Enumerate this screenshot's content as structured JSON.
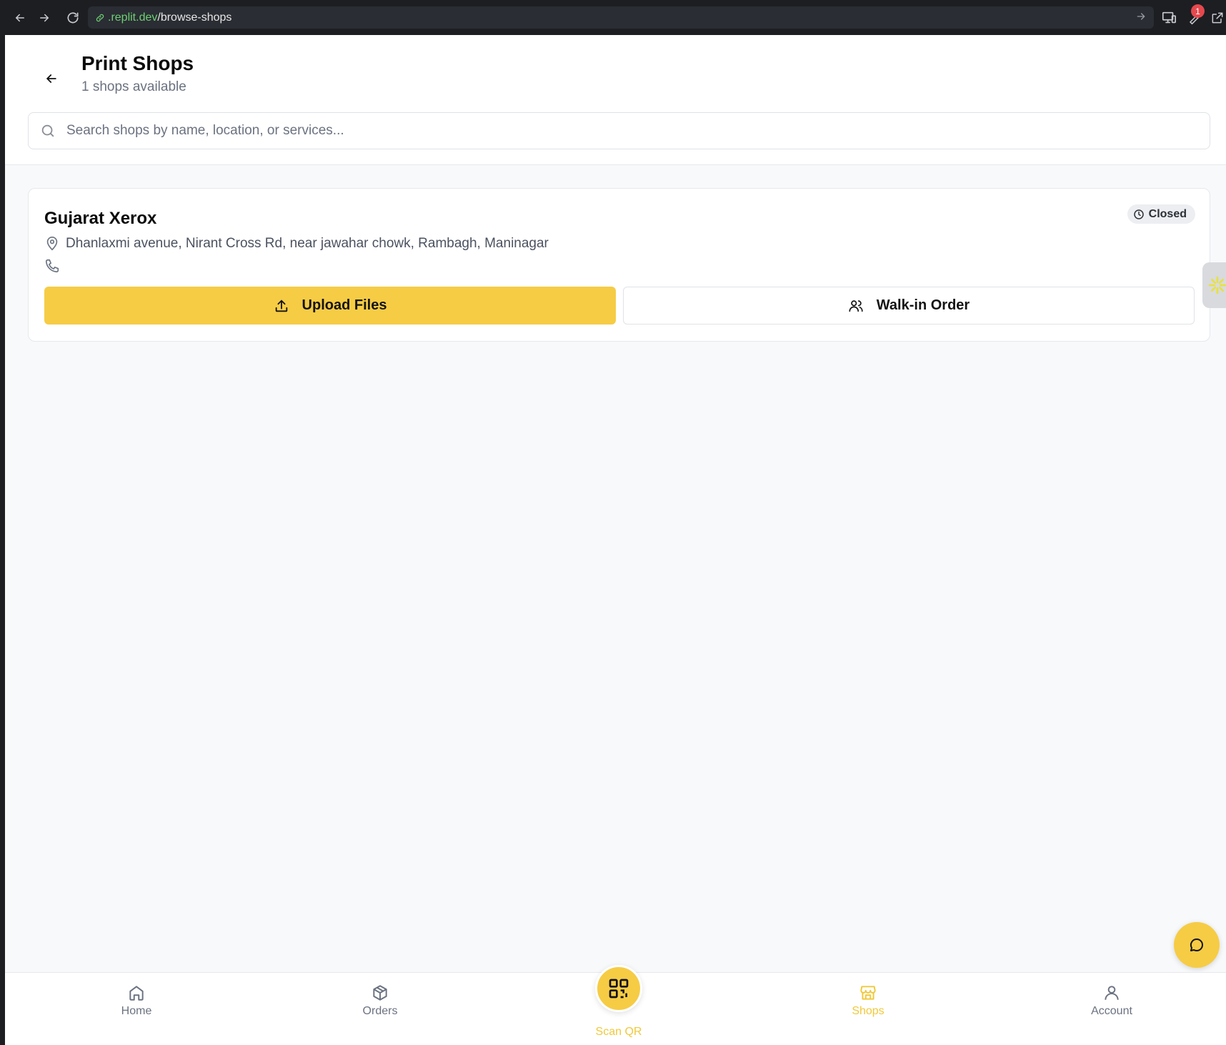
{
  "browser": {
    "url_host": ".replit.dev",
    "url_path": "/browse-shops",
    "notification_count": "1"
  },
  "header": {
    "title": "Print Shops",
    "subtitle": "1 shops available"
  },
  "search": {
    "placeholder": "Search shops by name, location, or services..."
  },
  "shops": [
    {
      "name": "Gujarat Xerox",
      "status": "Closed",
      "address": "Dhanlaxmi avenue, Nirant Cross Rd, near jawahar chowk, Rambagh, Maninagar",
      "upload_label": "Upload Files",
      "walkin_label": "Walk-in Order"
    }
  ],
  "bottom_nav": {
    "home": "Home",
    "orders": "Orders",
    "scan": "Scan QR",
    "shops": "Shops",
    "account": "Account",
    "active": "Shops"
  },
  "colors": {
    "accent": "#f6cc45",
    "active_nav": "#f0c93a"
  }
}
